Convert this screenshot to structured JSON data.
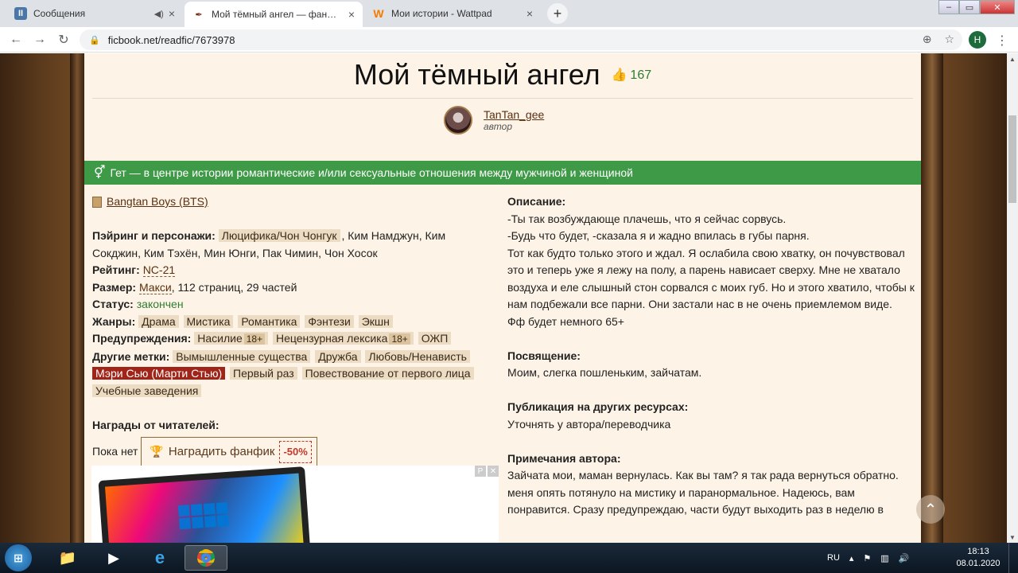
{
  "browser": {
    "tabs": [
      {
        "title": "Сообщения",
        "favicon": "II"
      },
      {
        "title": "Мой тёмный ангел — фанфик по",
        "favicon": "✒"
      },
      {
        "title": "Мои истории - Wattpad",
        "favicon": "W"
      }
    ],
    "url": "ficbook.net/readfic/7673978",
    "profile_initial": "Н"
  },
  "fic": {
    "title": "Мой тёмный ангел",
    "likes": "167",
    "author_name": "TanTan_gee",
    "author_role": "автор",
    "direction": "Гет — в центре истории романтические и/или сексуальные отношения между мужчиной и женщиной",
    "fandom": "Bangtan Boys (BTS)",
    "pairing_label": "Пэйринг и персонажи:",
    "pairing_main": "Люцифика/Чон Чонгук",
    "pairing_rest": ", Ким Намджун, Ким Сокджин, Ким Тэхён, Мин Юнги, Пак Чимин, Чон Хосок",
    "rating_label": "Рейтинг:",
    "rating": "NC-21",
    "size_label": "Размер:",
    "size_value": "Макси",
    "size_rest": ", 112 страниц, 29 частей",
    "status_label": "Статус:",
    "status": "закончен",
    "genres_label": "Жанры:",
    "genres": [
      "Драма",
      "Мистика",
      "Романтика",
      "Фэнтези",
      "Экшн"
    ],
    "warnings_label": "Предупреждения:",
    "warnings": [
      {
        "name": "Насилие",
        "age": "18+"
      },
      {
        "name": "Нецензурная лексика",
        "age": "18+"
      },
      {
        "name": "ОЖП",
        "age": ""
      }
    ],
    "tags_label": "Другие метки:",
    "tags": [
      "Вымышленные существа",
      "Дружба",
      "Любовь/Ненависть"
    ],
    "tag_highlight": "Мэри Сью (Марти Стью)",
    "tags2": [
      "Первый раз",
      "Повествование от первого лица",
      "Учебные заведения"
    ],
    "rewards_label": "Награды от читателей:",
    "rewards_none": "Пока нет",
    "award_button": "Наградить фанфик",
    "award_discount": "-50%"
  },
  "details": {
    "description_label": "Описание:",
    "description_lines": [
      "-Ты так возбуждающе плачешь, что я сейчас сорвусь.",
      "-Будь что будет, -сказала я и жадно впилась в губы парня.",
      "Тот как будто только этого и ждал. Я ослабила свою хватку, он почувствовал это и теперь уже я лежу на полу, а парень нависает сверху. Мне не хватало воздуха и еле слышный стон сорвался с моих губ. Но и этого хватило, чтобы к нам подбежали все парни. Они застали нас в не очень приемлемом виде.",
      "Фф будет немного 65+"
    ],
    "dedication_label": "Посвящение:",
    "dedication": "Моим, слегка пошленьким, зайчатам.",
    "publication_label": "Публикация на других ресурсах:",
    "publication": "Уточнять у автора/переводчика",
    "notes_label": "Примечания автора:",
    "notes_line1": "Зайчата мои, маман вернулась. Как вы там? я так рада вернуться обратно.",
    "notes_line2": "меня опять потянуло на мистику и паранормальное. Надеюсь, вам понравится. Сразу предупреждаю, части будут выходить раз в неделю в"
  },
  "taskbar": {
    "lang": "RU",
    "time": "18:13",
    "date": "08.01.2020"
  }
}
